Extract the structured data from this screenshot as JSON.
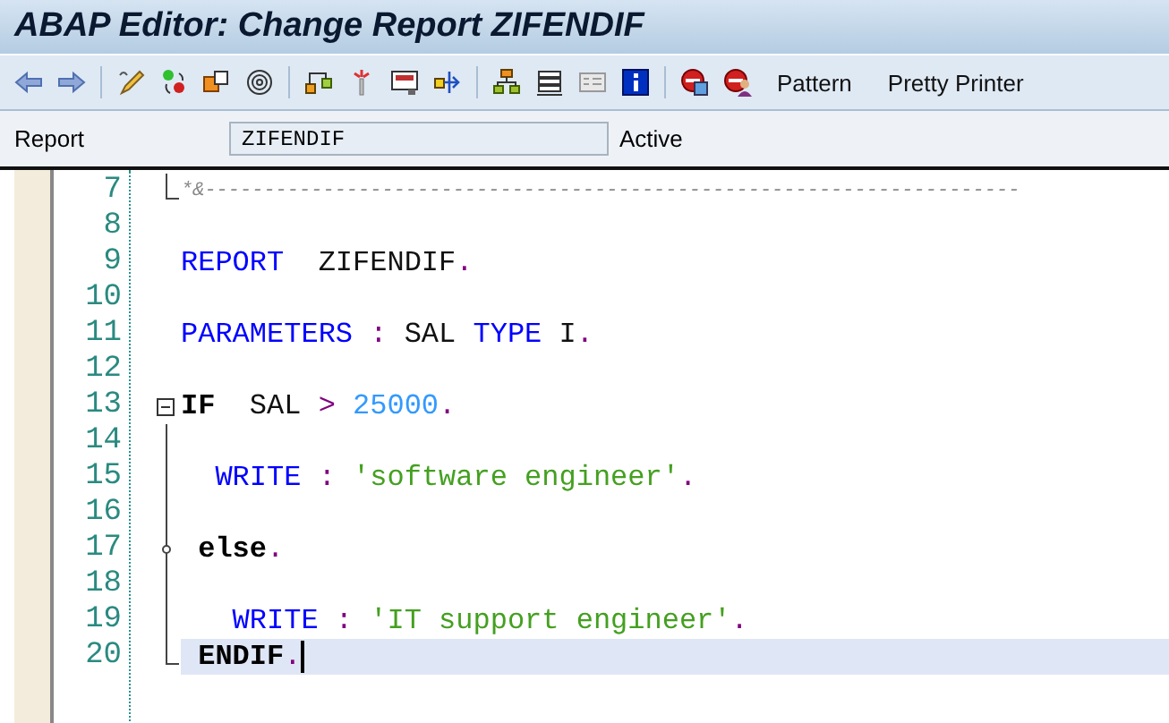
{
  "window": {
    "title": "ABAP Editor: Change Report ZIFENDIF"
  },
  "toolbar": {
    "icons": [
      {
        "kind": "back"
      },
      {
        "kind": "forward"
      },
      {
        "sep": true,
        "kind": "pencil"
      },
      {
        "kind": "toggle"
      },
      {
        "kind": "copy"
      },
      {
        "kind": "spiral"
      },
      {
        "sep": true,
        "kind": "where"
      },
      {
        "kind": "spark"
      },
      {
        "kind": "screen"
      },
      {
        "kind": "share"
      },
      {
        "sep": true,
        "kind": "tree"
      },
      {
        "kind": "stack"
      },
      {
        "kind": "list"
      },
      {
        "kind": "info"
      },
      {
        "sep": true,
        "kind": "stop"
      },
      {
        "kind": "stopuser"
      }
    ],
    "buttons": [
      "Pattern",
      "Pretty Printer"
    ]
  },
  "header": {
    "label": "Report",
    "value": "ZIFENDIF",
    "status": "Active"
  },
  "editor": {
    "lines": [
      {
        "number": "7",
        "kind": "fold_end",
        "current": false,
        "tokens": [
          {
            "kind": "comment",
            "text": "*&---------------------------------------------------------------------"
          }
        ]
      },
      {
        "number": "8",
        "kind": "plain",
        "current": false
      },
      {
        "number": "9",
        "kind": "plain",
        "current": false,
        "tokens": [
          {
            "kind": "keyword",
            "text": "REPORT"
          },
          {
            "kind": "ident",
            "text": "  ZIFENDIF"
          },
          {
            "kind": "punct",
            "text": "."
          }
        ]
      },
      {
        "number": "10",
        "kind": "plain",
        "current": false
      },
      {
        "number": "11",
        "kind": "plain",
        "current": false,
        "tokens": [
          {
            "kind": "keyword",
            "text": "PARAMETERS"
          },
          {
            "kind": "punct",
            "text": " : "
          },
          {
            "kind": "ident",
            "text": "SAL "
          },
          {
            "kind": "keyword",
            "text": "TYPE"
          },
          {
            "kind": "ident",
            "text": " I"
          },
          {
            "kind": "punct",
            "text": "."
          }
        ]
      },
      {
        "number": "12",
        "kind": "plain",
        "current": false
      },
      {
        "number": "13",
        "kind": "fold_start",
        "current": false,
        "tokens": [
          {
            "kind": "bold",
            "text": "IF"
          },
          {
            "kind": "ident",
            "text": "  SAL "
          },
          {
            "kind": "punct",
            "text": ">"
          },
          {
            "kind": "number",
            "text": " 25000"
          },
          {
            "kind": "punct",
            "text": "."
          }
        ]
      },
      {
        "number": "14",
        "kind": "fold_line",
        "current": false
      },
      {
        "number": "15",
        "kind": "fold_line",
        "current": false,
        "tokens": [
          {
            "kind": "keyword",
            "text": "  WRITE"
          },
          {
            "kind": "punct",
            "text": " : "
          },
          {
            "kind": "string",
            "text": "'software engineer'"
          },
          {
            "kind": "punct",
            "text": "."
          }
        ]
      },
      {
        "number": "16",
        "kind": "fold_line",
        "current": false
      },
      {
        "number": "17",
        "kind": "fold_branch",
        "current": false,
        "tokens": [
          {
            "kind": "bold",
            "text": " else"
          },
          {
            "kind": "punct",
            "text": "."
          }
        ]
      },
      {
        "number": "18",
        "kind": "fold_line",
        "current": false
      },
      {
        "number": "19",
        "kind": "fold_line",
        "current": false,
        "tokens": [
          {
            "kind": "keyword",
            "text": "   WRITE"
          },
          {
            "kind": "punct",
            "text": " : "
          },
          {
            "kind": "string",
            "text": "'IT support engineer'"
          },
          {
            "kind": "punct",
            "text": "."
          }
        ]
      },
      {
        "number": "20",
        "kind": "fold_end",
        "current": true,
        "tokens": [
          {
            "kind": "bold",
            "text": " ENDIF"
          },
          {
            "kind": "punct",
            "text": "."
          }
        ]
      }
    ]
  }
}
